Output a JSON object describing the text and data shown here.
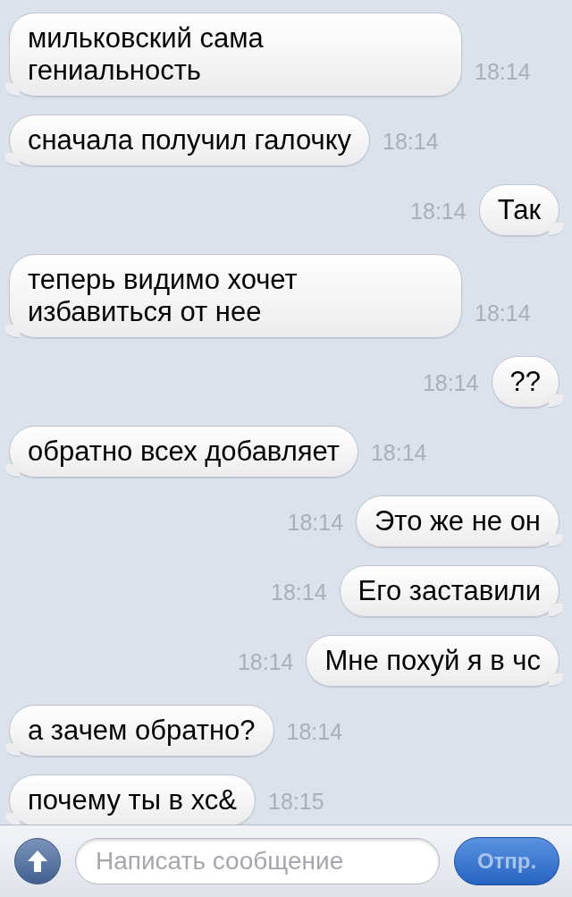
{
  "messages": [
    {
      "kind": "incoming",
      "text": "мильковский сама гениальность",
      "time": "18:14"
    },
    {
      "kind": "incoming",
      "text": "сначала получил галочку",
      "time": "18:14"
    },
    {
      "kind": "outgoing",
      "text": "Так",
      "time": "18:14"
    },
    {
      "kind": "incoming",
      "text": "теперь видимо хочет избавиться от нее",
      "time": "18:14"
    },
    {
      "kind": "outgoing",
      "text": "??",
      "time": "18:14"
    },
    {
      "kind": "incoming",
      "text": "обратно всех добавляет",
      "time": "18:14"
    },
    {
      "kind": "outgoing",
      "text": "Это же не он",
      "time": "18:14"
    },
    {
      "kind": "outgoing",
      "text": "Его заставили",
      "time": "18:14"
    },
    {
      "kind": "outgoing",
      "text": "Мне похуй я в чс",
      "time": "18:14"
    },
    {
      "kind": "incoming",
      "text": "а зачем обратно?",
      "time": "18:14"
    },
    {
      "kind": "incoming",
      "text": "почему ты в хс&",
      "time": "18:15"
    }
  ],
  "composer": {
    "placeholder": "Написать сообщение",
    "send_button": {
      "label": "Отпр.",
      "disabled": true
    }
  }
}
